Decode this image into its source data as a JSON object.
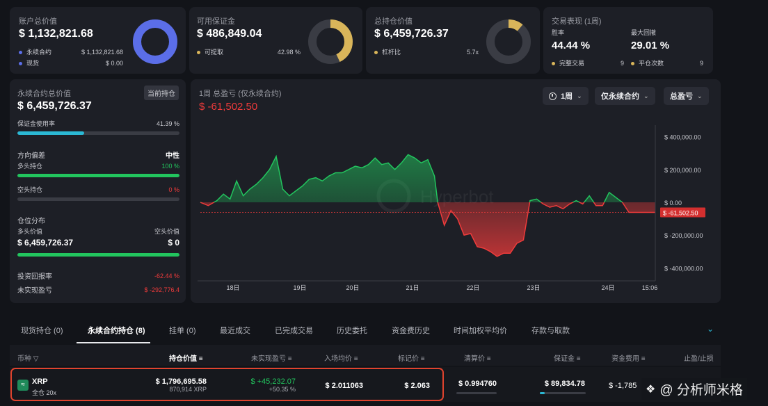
{
  "account": {
    "label": "账户总价值",
    "value": "$ 1,132,821.68",
    "rows": [
      {
        "label": "永续合约",
        "value": "$ 1,132,821.68",
        "color": "#5b6ee8"
      },
      {
        "label": "现货",
        "value": "$ 0.00",
        "color": "#5b6ee8"
      }
    ],
    "donut_fraction": 1.0,
    "donut_color": "#5b6ee8"
  },
  "margin": {
    "label": "可用保证金",
    "value": "$ 486,849.04",
    "rows": [
      {
        "label": "可提取",
        "value": "42.98 %",
        "color": "#d9b55a"
      }
    ],
    "donut_fraction": 0.4298,
    "donut_color": "#d9b55a"
  },
  "position": {
    "label": "总持仓价值",
    "value": "$ 6,459,726.37",
    "rows": [
      {
        "label": "杠杆比",
        "value": "5.7x",
        "color": "#d9b55a"
      }
    ],
    "donut_fraction": 0.11,
    "donut_color": "#d9b55a"
  },
  "performance": {
    "label": "交易表现 (1周)",
    "winrate_label": "胜率",
    "winrate": "44.44 %",
    "drawdown_label": "最大回撤",
    "drawdown": "29.01 %",
    "completed_label": "完整交易",
    "completed": "9",
    "closed_label": "平仓次数",
    "closed": "9"
  },
  "perp": {
    "label": "永续合约总价值",
    "tag": "当前持仓",
    "value": "$ 6,459,726.37",
    "margin_usage_label": "保证金使用率",
    "margin_usage": "41.39 %",
    "margin_usage_fraction": 0.4139,
    "bias_label": "方向偏差",
    "bias_value": "中性",
    "long_label": "多头持仓",
    "long_pct": "100 %",
    "long_fraction": 1.0,
    "short_label": "空头持仓",
    "short_pct": "0 %",
    "short_fraction": 0.0,
    "dist_label": "仓位分布",
    "long_value_label": "多头价值",
    "short_value_label": "空头价值",
    "long_value": "$ 6,459,726.37",
    "short_value": "$ 0",
    "roi_label": "投资回报率",
    "roi": "-62.44 %",
    "upnl_label": "未实现盈亏",
    "upnl": "$ -292,776.4"
  },
  "chart_header": {
    "title": "1周 总盈亏 (仅永续合约)",
    "value": "$ -61,502.50",
    "dd_period": "1周",
    "dd_scope": "仅永续合约",
    "dd_metric": "总盈亏",
    "watermark": "Hyperbot"
  },
  "chart_data": {
    "type": "area",
    "title": "1周 总盈亏 (仅永续合约)",
    "x_ticks": [
      "18日",
      "19日",
      "20日",
      "21日",
      "22日",
      "23日",
      "24日",
      "15:06"
    ],
    "y_ticks": [
      "$ 400,000.00",
      "$ 200,000.00",
      "$ 0.00",
      "$ -200,000.00",
      "$ -400,000.00"
    ],
    "ylim": [
      -470000,
      470000
    ],
    "current_label": "$ -61,502.50",
    "current_value": -61502.5,
    "x": [
      0,
      0.12,
      0.25,
      0.35,
      0.45,
      0.55,
      0.65,
      0.75,
      0.85,
      0.95,
      1.05,
      1.15,
      1.25,
      1.35,
      1.45,
      1.55,
      1.65,
      1.75,
      1.85,
      1.95,
      2.05,
      2.15,
      2.25,
      2.35,
      2.45,
      2.55,
      2.65,
      2.75,
      2.85,
      2.95,
      3.05,
      3.15,
      3.25,
      3.35,
      3.45,
      3.55,
      3.6,
      3.7,
      3.8,
      3.9,
      4.0,
      4.1,
      4.2,
      4.3,
      4.4,
      4.5,
      4.6,
      4.7,
      4.8,
      4.9,
      5.0,
      5.1,
      5.2,
      5.3,
      5.4,
      5.5,
      5.6,
      5.7,
      5.8,
      5.9,
      6.0,
      6.1,
      6.2,
      6.3,
      6.4,
      6.5,
      6.6,
      6.7,
      6.8,
      6.9
    ],
    "values": [
      0,
      -20000,
      10000,
      50000,
      20000,
      130000,
      40000,
      80000,
      110000,
      150000,
      200000,
      280000,
      80000,
      40000,
      70000,
      100000,
      140000,
      150000,
      130000,
      160000,
      180000,
      180000,
      200000,
      220000,
      210000,
      230000,
      270000,
      230000,
      240000,
      200000,
      240000,
      290000,
      270000,
      240000,
      260000,
      160000,
      0,
      -140000,
      -50000,
      -100000,
      -200000,
      -190000,
      -270000,
      -280000,
      -300000,
      -330000,
      -310000,
      -310000,
      -250000,
      -230000,
      10000,
      20000,
      -10000,
      -30000,
      -20000,
      -40000,
      -10000,
      10000,
      -10000,
      40000,
      -20000,
      -20000,
      60000,
      30000,
      0,
      -61502.5,
      -61502.5,
      -61502.5,
      -61502.5,
      -61502.5
    ],
    "up_color": "#22c55e",
    "down_color": "#ef3b3b"
  },
  "tabs": [
    "现货持仓 (0)",
    "永续合约持仓 (8)",
    "挂单 (0)",
    "最近成交",
    "已完成交易",
    "历史委托",
    "资金费历史",
    "时间加权平均价",
    "存款与取款"
  ],
  "active_tab": 1,
  "table": {
    "headers": [
      "币种",
      "持仓价值",
      "未实现盈亏",
      "入场均价",
      "标记价",
      "清算价",
      "保证金",
      "资金费用",
      "止盈/止损"
    ],
    "row": {
      "coin": "XRP",
      "mode": "全仓 20x",
      "value": "$ 1,796,695.58",
      "size": "870,914 XRP",
      "upnl": "$ +45,232.07",
      "upnl_pct": "+50.35 %",
      "entry": "$ 2.011063",
      "mark": "$ 2.063",
      "liq": "$ 0.994760",
      "margin": "$ 89,834.78",
      "funding": "$ -1,785"
    }
  },
  "watermark_footer": "@ 分析师米格"
}
